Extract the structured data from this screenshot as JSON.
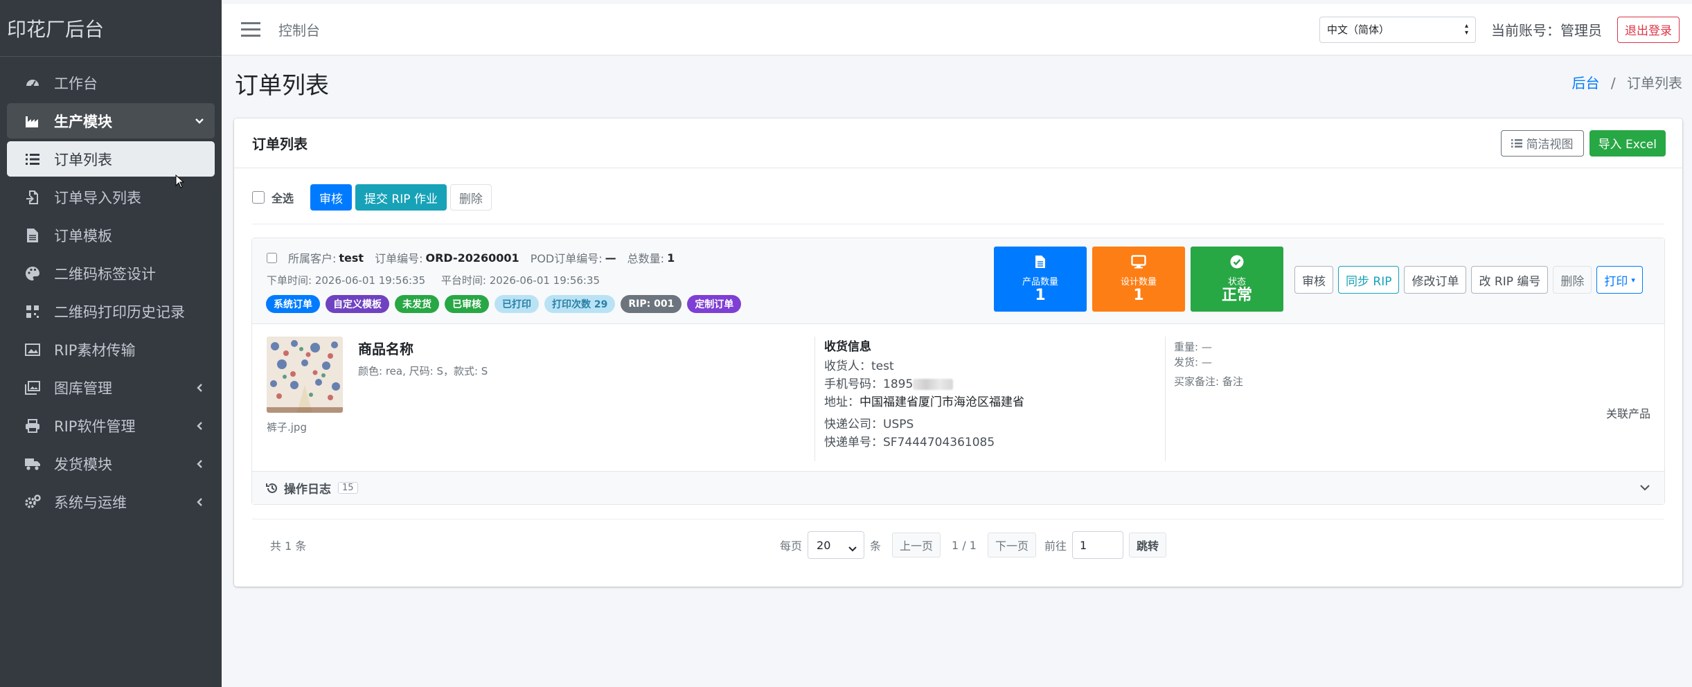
{
  "sidebar": {
    "brand": "印花厂后台",
    "items": [
      {
        "label": "工作台",
        "icon": "dashboard-icon"
      },
      {
        "label": "生产模块",
        "icon": "factory-icon"
      },
      {
        "label": "订单列表",
        "icon": "list-icon"
      },
      {
        "label": "订单导入列表",
        "icon": "file-import-icon"
      },
      {
        "label": "订单模板",
        "icon": "file-icon"
      },
      {
        "label": "二维码标签设计",
        "icon": "palette-icon"
      },
      {
        "label": "二维码打印历史记录",
        "icon": "qrcode-icon"
      },
      {
        "label": "RIP素材传输",
        "icon": "image-icon"
      },
      {
        "label": "图库管理",
        "icon": "images-icon"
      },
      {
        "label": "RIP软件管理",
        "icon": "printer-icon"
      },
      {
        "label": "发货模块",
        "icon": "truck-icon"
      },
      {
        "label": "系统与运维",
        "icon": "cogs-icon"
      }
    ]
  },
  "topbar": {
    "title": "控制台",
    "language": "中文（简体）",
    "account": "当前账号：管理员",
    "logout": "退出登录"
  },
  "page": {
    "title": "订单列表",
    "breadcrumb_home": "后台",
    "breadcrumb_sep": "/",
    "breadcrumb_current": "订单列表"
  },
  "card": {
    "title": "订单列表",
    "simple_view": "简洁视图",
    "import_excel": "导入 Excel"
  },
  "actions": {
    "select_all": "全选",
    "approve": "审核",
    "submit_rip": "提交 RIP 作业",
    "delete": "删除"
  },
  "order": {
    "customer_label": "所属客户:",
    "customer": "test",
    "order_no_label": "订单编号:",
    "order_no": "ORD-20260001",
    "pod_label": "POD订单编号:",
    "pod": "—",
    "qty_label": "总数量:",
    "qty": "1",
    "order_time": "下单时间: 2026-06-01 19:56:35",
    "platform_time": "平台时间: 2026-06-01 19:56:35",
    "badges": [
      {
        "label": "系统订单",
        "color": "#007bff"
      },
      {
        "label": "自定义模板",
        "color": "#6f42c1"
      },
      {
        "label": "未发货",
        "color": "#28a745"
      },
      {
        "label": "已审核",
        "color": "#28a745"
      },
      {
        "label": "已打印",
        "color": "#a8d8f0"
      },
      {
        "label": "打印次数 29",
        "color": "#a8d8f0"
      },
      {
        "label": "RIP: 001",
        "color": "#6c757d"
      },
      {
        "label": "定制订单",
        "color": "#7e3fd4"
      }
    ],
    "stats": [
      {
        "label": "产品数量",
        "value": "1",
        "color": "#007bff",
        "icon": "file-icon"
      },
      {
        "label": "设计数量",
        "value": "1",
        "color": "#fd7e14",
        "icon": "monitor-icon"
      },
      {
        "label": "状态",
        "value": "正常",
        "color": "#28a745",
        "icon": "check-circle-icon"
      }
    ],
    "ops": {
      "approve": "审核",
      "sync_rip": "同步 RIP",
      "edit": "修改订单",
      "change_rip": "改 RIP 编号",
      "delete": "删除",
      "print": "打印"
    },
    "product": {
      "name": "商品名称",
      "attrs": "颜色: rea, 尺码: S，款式: S",
      "file": "裤子.jpg"
    },
    "shipping": {
      "heading": "收货信息",
      "receiver": "收货人：test",
      "phone_prefix": "手机号码：1895",
      "address_label": "地址：",
      "address": "中国福建省厦门市海沧区福建省",
      "courier": "快递公司：USPS",
      "tracking": "快递单号：SF7444704361085"
    },
    "meta": {
      "weight": "重量: —",
      "ship": "发货: —",
      "buyer_note": "买家备注: 备注"
    },
    "related": "关联产品",
    "log_title": "操作日志",
    "log_count": "15"
  },
  "pagination": {
    "total": "共 1 条",
    "per_page_label": "每页",
    "per_page": "20",
    "unit": "条",
    "prev": "上一页",
    "page_info": "1 / 1",
    "next": "下一页",
    "goto_label": "前往",
    "goto_value": "1",
    "jump": "跳转"
  }
}
